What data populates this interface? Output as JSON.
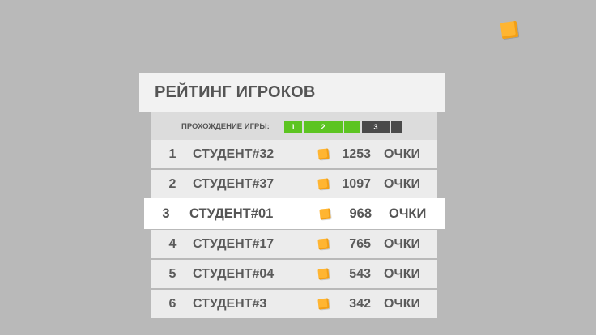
{
  "leaderboard": {
    "title": "РЕЙТИНГ ИГРОКОВ",
    "progress": {
      "label": "ПРОХОЖДЕНИЕ ИГРЫ:",
      "segments": [
        {
          "label": "1",
          "state": "completed"
        },
        {
          "label": "2",
          "state": "completed"
        },
        {
          "label": "3",
          "state": "current"
        },
        {
          "label": "",
          "state": "locked"
        }
      ]
    },
    "rows": [
      {
        "rank": "1",
        "name": "СТУДЕНТ#32",
        "score": "1253",
        "unit": "ОЧКИ",
        "highlighted": false
      },
      {
        "rank": "2",
        "name": "СТУДЕНТ#37",
        "score": "1097",
        "unit": "ОЧКИ",
        "highlighted": false
      },
      {
        "rank": "3",
        "name": "СТУДЕНТ#01",
        "score": "968",
        "unit": "ОЧКИ",
        "highlighted": true
      },
      {
        "rank": "4",
        "name": "СТУДЕНТ#17",
        "score": "765",
        "unit": "ОЧКИ",
        "highlighted": false
      },
      {
        "rank": "5",
        "name": "СТУДЕНТ#04",
        "score": "543",
        "unit": "ОЧКИ",
        "highlighted": false
      },
      {
        "rank": "6",
        "name": "СТУДЕНТ#3",
        "score": "342",
        "unit": "ОЧКИ",
        "highlighted": false
      }
    ]
  },
  "icons": {
    "coin": "coin-icon"
  },
  "colors": {
    "background": "#b9b9b9",
    "panel": "#ececec",
    "highlight_row": "#ffffff",
    "progress_done": "#5cc421",
    "progress_pending": "#4a4a4a",
    "coin": "#ffb531",
    "text": "#5a5a5a"
  }
}
